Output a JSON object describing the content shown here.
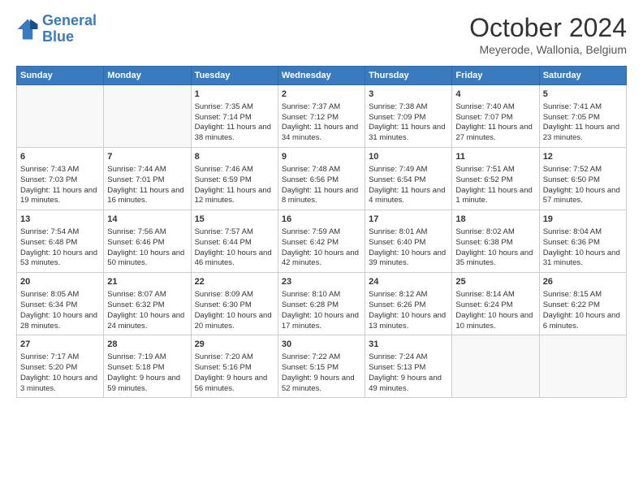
{
  "header": {
    "logo_line1": "General",
    "logo_line2": "Blue",
    "month_title": "October 2024",
    "location": "Meyerode, Wallonia, Belgium"
  },
  "weekdays": [
    "Sunday",
    "Monday",
    "Tuesday",
    "Wednesday",
    "Thursday",
    "Friday",
    "Saturday"
  ],
  "weeks": [
    [
      {
        "day": "",
        "sunrise": "",
        "sunset": "",
        "daylight": ""
      },
      {
        "day": "",
        "sunrise": "",
        "sunset": "",
        "daylight": ""
      },
      {
        "day": "1",
        "sunrise": "Sunrise: 7:35 AM",
        "sunset": "Sunset: 7:14 PM",
        "daylight": "Daylight: 11 hours and 38 minutes."
      },
      {
        "day": "2",
        "sunrise": "Sunrise: 7:37 AM",
        "sunset": "Sunset: 7:12 PM",
        "daylight": "Daylight: 11 hours and 34 minutes."
      },
      {
        "day": "3",
        "sunrise": "Sunrise: 7:38 AM",
        "sunset": "Sunset: 7:09 PM",
        "daylight": "Daylight: 11 hours and 31 minutes."
      },
      {
        "day": "4",
        "sunrise": "Sunrise: 7:40 AM",
        "sunset": "Sunset: 7:07 PM",
        "daylight": "Daylight: 11 hours and 27 minutes."
      },
      {
        "day": "5",
        "sunrise": "Sunrise: 7:41 AM",
        "sunset": "Sunset: 7:05 PM",
        "daylight": "Daylight: 11 hours and 23 minutes."
      }
    ],
    [
      {
        "day": "6",
        "sunrise": "Sunrise: 7:43 AM",
        "sunset": "Sunset: 7:03 PM",
        "daylight": "Daylight: 11 hours and 19 minutes."
      },
      {
        "day": "7",
        "sunrise": "Sunrise: 7:44 AM",
        "sunset": "Sunset: 7:01 PM",
        "daylight": "Daylight: 11 hours and 16 minutes."
      },
      {
        "day": "8",
        "sunrise": "Sunrise: 7:46 AM",
        "sunset": "Sunset: 6:59 PM",
        "daylight": "Daylight: 11 hours and 12 minutes."
      },
      {
        "day": "9",
        "sunrise": "Sunrise: 7:48 AM",
        "sunset": "Sunset: 6:56 PM",
        "daylight": "Daylight: 11 hours and 8 minutes."
      },
      {
        "day": "10",
        "sunrise": "Sunrise: 7:49 AM",
        "sunset": "Sunset: 6:54 PM",
        "daylight": "Daylight: 11 hours and 4 minutes."
      },
      {
        "day": "11",
        "sunrise": "Sunrise: 7:51 AM",
        "sunset": "Sunset: 6:52 PM",
        "daylight": "Daylight: 11 hours and 1 minute."
      },
      {
        "day": "12",
        "sunrise": "Sunrise: 7:52 AM",
        "sunset": "Sunset: 6:50 PM",
        "daylight": "Daylight: 10 hours and 57 minutes."
      }
    ],
    [
      {
        "day": "13",
        "sunrise": "Sunrise: 7:54 AM",
        "sunset": "Sunset: 6:48 PM",
        "daylight": "Daylight: 10 hours and 53 minutes."
      },
      {
        "day": "14",
        "sunrise": "Sunrise: 7:56 AM",
        "sunset": "Sunset: 6:46 PM",
        "daylight": "Daylight: 10 hours and 50 minutes."
      },
      {
        "day": "15",
        "sunrise": "Sunrise: 7:57 AM",
        "sunset": "Sunset: 6:44 PM",
        "daylight": "Daylight: 10 hours and 46 minutes."
      },
      {
        "day": "16",
        "sunrise": "Sunrise: 7:59 AM",
        "sunset": "Sunset: 6:42 PM",
        "daylight": "Daylight: 10 hours and 42 minutes."
      },
      {
        "day": "17",
        "sunrise": "Sunrise: 8:01 AM",
        "sunset": "Sunset: 6:40 PM",
        "daylight": "Daylight: 10 hours and 39 minutes."
      },
      {
        "day": "18",
        "sunrise": "Sunrise: 8:02 AM",
        "sunset": "Sunset: 6:38 PM",
        "daylight": "Daylight: 10 hours and 35 minutes."
      },
      {
        "day": "19",
        "sunrise": "Sunrise: 8:04 AM",
        "sunset": "Sunset: 6:36 PM",
        "daylight": "Daylight: 10 hours and 31 minutes."
      }
    ],
    [
      {
        "day": "20",
        "sunrise": "Sunrise: 8:05 AM",
        "sunset": "Sunset: 6:34 PM",
        "daylight": "Daylight: 10 hours and 28 minutes."
      },
      {
        "day": "21",
        "sunrise": "Sunrise: 8:07 AM",
        "sunset": "Sunset: 6:32 PM",
        "daylight": "Daylight: 10 hours and 24 minutes."
      },
      {
        "day": "22",
        "sunrise": "Sunrise: 8:09 AM",
        "sunset": "Sunset: 6:30 PM",
        "daylight": "Daylight: 10 hours and 20 minutes."
      },
      {
        "day": "23",
        "sunrise": "Sunrise: 8:10 AM",
        "sunset": "Sunset: 6:28 PM",
        "daylight": "Daylight: 10 hours and 17 minutes."
      },
      {
        "day": "24",
        "sunrise": "Sunrise: 8:12 AM",
        "sunset": "Sunset: 6:26 PM",
        "daylight": "Daylight: 10 hours and 13 minutes."
      },
      {
        "day": "25",
        "sunrise": "Sunrise: 8:14 AM",
        "sunset": "Sunset: 6:24 PM",
        "daylight": "Daylight: 10 hours and 10 minutes."
      },
      {
        "day": "26",
        "sunrise": "Sunrise: 8:15 AM",
        "sunset": "Sunset: 6:22 PM",
        "daylight": "Daylight: 10 hours and 6 minutes."
      }
    ],
    [
      {
        "day": "27",
        "sunrise": "Sunrise: 7:17 AM",
        "sunset": "Sunset: 5:20 PM",
        "daylight": "Daylight: 10 hours and 3 minutes."
      },
      {
        "day": "28",
        "sunrise": "Sunrise: 7:19 AM",
        "sunset": "Sunset: 5:18 PM",
        "daylight": "Daylight: 9 hours and 59 minutes."
      },
      {
        "day": "29",
        "sunrise": "Sunrise: 7:20 AM",
        "sunset": "Sunset: 5:16 PM",
        "daylight": "Daylight: 9 hours and 56 minutes."
      },
      {
        "day": "30",
        "sunrise": "Sunrise: 7:22 AM",
        "sunset": "Sunset: 5:15 PM",
        "daylight": "Daylight: 9 hours and 52 minutes."
      },
      {
        "day": "31",
        "sunrise": "Sunrise: 7:24 AM",
        "sunset": "Sunset: 5:13 PM",
        "daylight": "Daylight: 9 hours and 49 minutes."
      },
      {
        "day": "",
        "sunrise": "",
        "sunset": "",
        "daylight": ""
      },
      {
        "day": "",
        "sunrise": "",
        "sunset": "",
        "daylight": ""
      }
    ]
  ]
}
